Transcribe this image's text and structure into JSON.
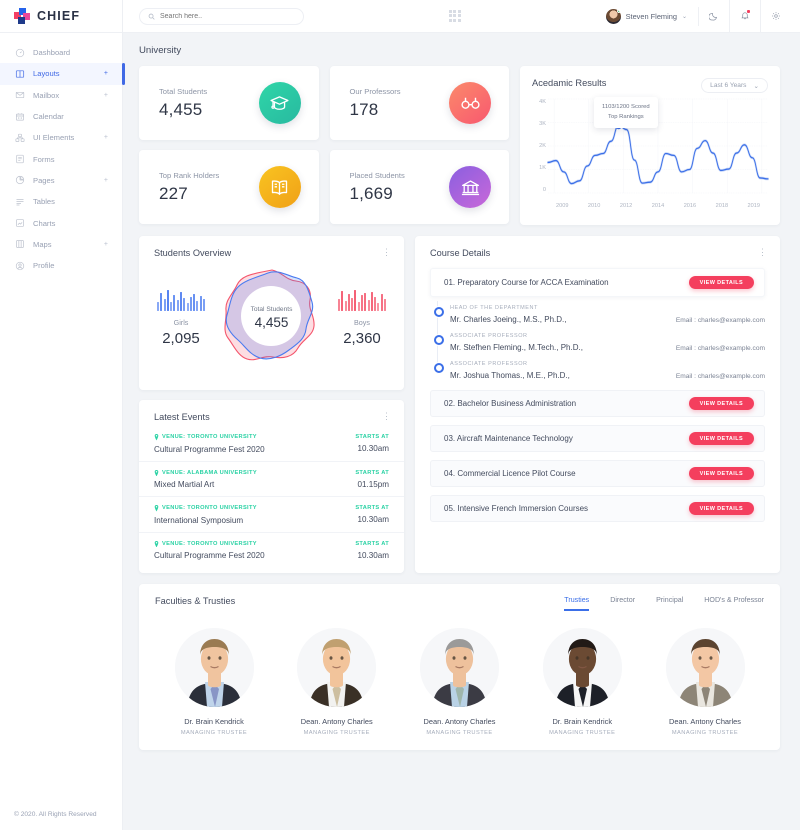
{
  "brand": {
    "name": "CHIEF"
  },
  "sidebar": {
    "items": [
      {
        "label": "Dashboard",
        "icon": "dashboard-icon",
        "expandable": false,
        "active": false
      },
      {
        "label": "Layouts",
        "icon": "layouts-icon",
        "expandable": true,
        "active": true
      },
      {
        "label": "Mailbox",
        "icon": "mail-icon",
        "expandable": true,
        "active": false
      },
      {
        "label": "Calendar",
        "icon": "calendar-icon",
        "expandable": false,
        "active": false
      },
      {
        "label": "UI Elements",
        "icon": "ui-elements-icon",
        "expandable": true,
        "active": false
      },
      {
        "label": "Forms",
        "icon": "forms-icon",
        "expandable": false,
        "active": false
      },
      {
        "label": "Pages",
        "icon": "pages-icon",
        "expandable": true,
        "active": false
      },
      {
        "label": "Tables",
        "icon": "tables-icon",
        "expandable": false,
        "active": false
      },
      {
        "label": "Charts",
        "icon": "charts-icon",
        "expandable": false,
        "active": false
      },
      {
        "label": "Maps",
        "icon": "maps-icon",
        "expandable": true,
        "active": false
      },
      {
        "label": "Profile",
        "icon": "profile-icon",
        "expandable": false,
        "active": false
      }
    ],
    "expand_symbol": "+",
    "footer": "© 2020. All Rights Reserved"
  },
  "topbar": {
    "search_placeholder": "Search here..",
    "search_value": "",
    "apps_icon": "grid-apps-icon",
    "user": {
      "name": "Steven Fleming",
      "caret": "⌄",
      "status": "online"
    },
    "theme_icon": "moon-icon",
    "notifications_icon": "bell-icon",
    "settings_icon": "gear-icon"
  },
  "page": {
    "title": "University"
  },
  "stats": [
    {
      "label": "Total Students",
      "value": "4,455",
      "icon": "graduation-cap-icon",
      "color_from": "#2fd6a8",
      "color_to": "#28b9a0"
    },
    {
      "label": "Our Professors",
      "value": "178",
      "icon": "glasses-icon",
      "color_from": "#fb8a6b",
      "color_to": "#f8586f"
    },
    {
      "label": "Top Rank Holders",
      "value": "227",
      "icon": "open-book-icon",
      "color_from": "#f9c421",
      "color_to": "#f0a017"
    },
    {
      "label": "Placed Students",
      "value": "1,669",
      "icon": "institution-icon",
      "color_from": "#8a5fe0",
      "color_to": "#c968d9"
    }
  ],
  "chart_card": {
    "title": "Acedamic Results",
    "range_label": "Last 6 Years",
    "range_caret": "⌄",
    "tooltip_line1": "1103/1200 Scored",
    "tooltip_line2": "Top Rankings"
  },
  "chart_data": {
    "type": "line",
    "title": "Acedamic Results",
    "xlabel": "",
    "ylabel": "",
    "ylim": [
      0,
      4000
    ],
    "ytick_labels": [
      "4K",
      "3K",
      "2K",
      "1K",
      "0"
    ],
    "ytick_values": [
      4000,
      3000,
      2000,
      1000,
      0
    ],
    "xtick_labels": [
      "2009",
      "2010",
      "2012",
      "2014",
      "2016",
      "2018",
      "2019"
    ],
    "grid": true,
    "legend": "none",
    "series": [
      {
        "name": "Scored",
        "color": "#3b6fe8",
        "values": [
          1300,
          1380,
          900,
          400,
          520,
          1150,
          1600,
          1680,
          2200,
          2880,
          2700,
          1400,
          420,
          460,
          900,
          1680,
          1600,
          900,
          1000,
          1900,
          2230,
          1700,
          960,
          1020,
          1700,
          2050,
          1500,
          640,
          600
        ]
      }
    ],
    "highlight_point": {
      "value": 2880,
      "label": "1103/1200 Scored Top Rankings"
    }
  },
  "students_overview": {
    "title": "Students Overview",
    "kebab": "⋮",
    "center_label": "Total Students",
    "center_value": "4,455",
    "girls": {
      "label": "Girls",
      "value": "2,095",
      "color": "#4a7bf0"
    },
    "boys": {
      "label": "Boys",
      "value": "2,360",
      "color": "#f4556c"
    },
    "girls_spark": [
      9,
      18,
      12,
      21,
      9,
      16,
      11,
      19,
      13,
      8,
      14,
      17,
      10,
      15,
      12
    ],
    "boys_spark": [
      12,
      20,
      10,
      17,
      13,
      21,
      9,
      16,
      18,
      11,
      19,
      14,
      8,
      17,
      12
    ]
  },
  "latest_events": {
    "title": "Latest Events",
    "kebab": "⋮",
    "starts_at_label": "STARTS AT",
    "events": [
      {
        "venue": "VENUE: TORONTO UNIVERSITY",
        "name": "Cultural Programme Fest 2020",
        "time": "10.30am"
      },
      {
        "venue": "VENUE: ALABAMA UNIVERSITY",
        "name": "Mixed Martial Art",
        "time": "01.15pm"
      },
      {
        "venue": "VENUE: TORONTO UNIVERSITY",
        "name": "International Symposium",
        "time": "10.30am"
      },
      {
        "venue": "VENUE: TORONTO UNIVERSITY",
        "name": "Cultural Programme Fest 2020",
        "time": "10.30am"
      }
    ]
  },
  "course_details": {
    "title": "Course Details",
    "kebab": "⋮",
    "view_details_label": "VIEW DETAILS",
    "courses": [
      {
        "name": "01. Preparatory Course for ACCA Examination"
      },
      {
        "name": "02. Bachelor Business Administration"
      },
      {
        "name": "03. Aircraft Maintenance Technology"
      },
      {
        "name": "04. Commercial Licence Pilot Course"
      },
      {
        "name": "05. Intensive French Immersion Courses"
      }
    ],
    "staff": [
      {
        "role": "HEAD OF THE DEPARTMENT",
        "name": "Mr. Charles Joeing., M.S., Ph.D.,",
        "email": "Email : charles@example.com"
      },
      {
        "role": "ASSOCIATE PROFESSOR",
        "name": "Mr. Stefhen Fleming., M.Tech., Ph.D.,",
        "email": "Email : charles@example.com"
      },
      {
        "role": "ASSOCIATE PROFESSOR",
        "name": "Mr. Joshua Thomas., M.E., Ph.D.,",
        "email": "Email : charles@example.com"
      }
    ]
  },
  "faculties": {
    "title": "Faculties & Trusties",
    "tabs": [
      {
        "label": "Trusties",
        "active": true
      },
      {
        "label": "Director",
        "active": false
      },
      {
        "label": "Principal",
        "active": false
      },
      {
        "label": "HOD's & Professor",
        "active": false
      }
    ],
    "people": [
      {
        "name": "Dr. Brain Kendrick",
        "role": "MANAGING TRUSTEE",
        "skin": "#f0c49f",
        "hair": "#9a7b52",
        "suit": "#2b2f3a",
        "shirt": "#bfd4ea",
        "tie": "#8895c6"
      },
      {
        "name": "Dean. Antony Charles",
        "role": "MANAGING TRUSTEE",
        "skin": "#f2c49b",
        "hair": "#c0a070",
        "suit": "#3a3026",
        "shirt": "#f2f2f0",
        "tie": "#cdbfa0"
      },
      {
        "name": "Dean. Antony Charles",
        "role": "MANAGING TRUSTEE",
        "skin": "#eec19c",
        "hair": "#9b9a99",
        "suit": "#3b3b44",
        "shirt": "#b9d2e6",
        "tie": "#9fb6ac"
      },
      {
        "name": "Dr. Brain Kendrick",
        "role": "MANAGING TRUSTEE",
        "skin": "#6b4a33",
        "hair": "#221a16",
        "suit": "#1d2028",
        "shirt": "#f6f6f6",
        "tie": "#1d2028"
      },
      {
        "name": "Dean. Antony Charles",
        "role": "MANAGING TRUSTEE",
        "skin": "#f3c7a4",
        "hair": "#5c4430",
        "suit": "#8d8577",
        "shirt": "#e9e6df",
        "tie": "#8d8577"
      }
    ]
  }
}
